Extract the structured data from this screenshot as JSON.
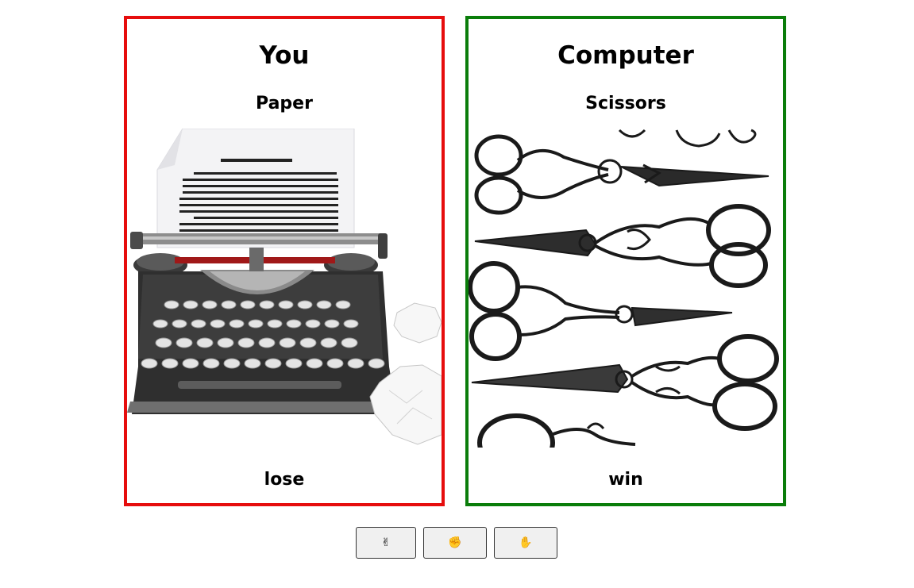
{
  "player": {
    "heading": "You",
    "choice": "Paper",
    "result": "lose",
    "border_color": "#e60d0d"
  },
  "computer": {
    "heading": "Computer",
    "choice": "Scissors",
    "result": "win",
    "border_color": "#0a7d0a"
  },
  "controls": {
    "rock_label": "✊",
    "paper_label": "✋",
    "scissors_label": "✌"
  },
  "images": {
    "player_image": "typewriter-with-paper",
    "computer_image": "ornate-scissors"
  }
}
